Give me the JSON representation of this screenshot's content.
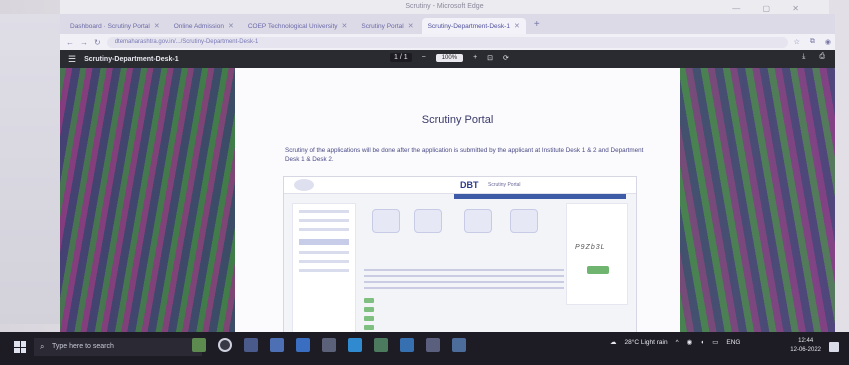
{
  "window": {
    "title": "Scrutiny - Microsoft Edge"
  },
  "tabs": [
    {
      "label": "Dashboard · Scrutiny Portal",
      "active": false
    },
    {
      "label": "Online Admission",
      "active": false
    },
    {
      "label": "COEP Technological University",
      "active": false
    },
    {
      "label": "Scrutiny Portal",
      "active": false
    },
    {
      "label": "Scrutiny-Department-Desk-1",
      "active": true
    }
  ],
  "address_bar": {
    "url": "dtemaharashtra.gov.in/.../Scrutiny-Department-Desk-1"
  },
  "pdf": {
    "document_name": "Scrutiny-Department-Desk-1",
    "page_indicator": "1 / 1",
    "zoom": "100%"
  },
  "page": {
    "title": "Scrutiny Portal",
    "body": "Scrutiny of the applications will be done after the application is submitted by the applicant at Institute Desk 1 & 2 and Department Desk 1 & Desk 2.",
    "embedded_screenshot": {
      "logo": "DBT",
      "subtitle": "Scrutiny Portal",
      "captcha": "P9Zb3L"
    }
  },
  "taskbar": {
    "search_placeholder": "Type here to search",
    "weather": "28°C Light rain",
    "language": "ENG",
    "time": "12:44",
    "date": "12-06-2022"
  },
  "colors": {
    "accent": "#3e5ba8",
    "taskbar": "#1d1c24"
  }
}
